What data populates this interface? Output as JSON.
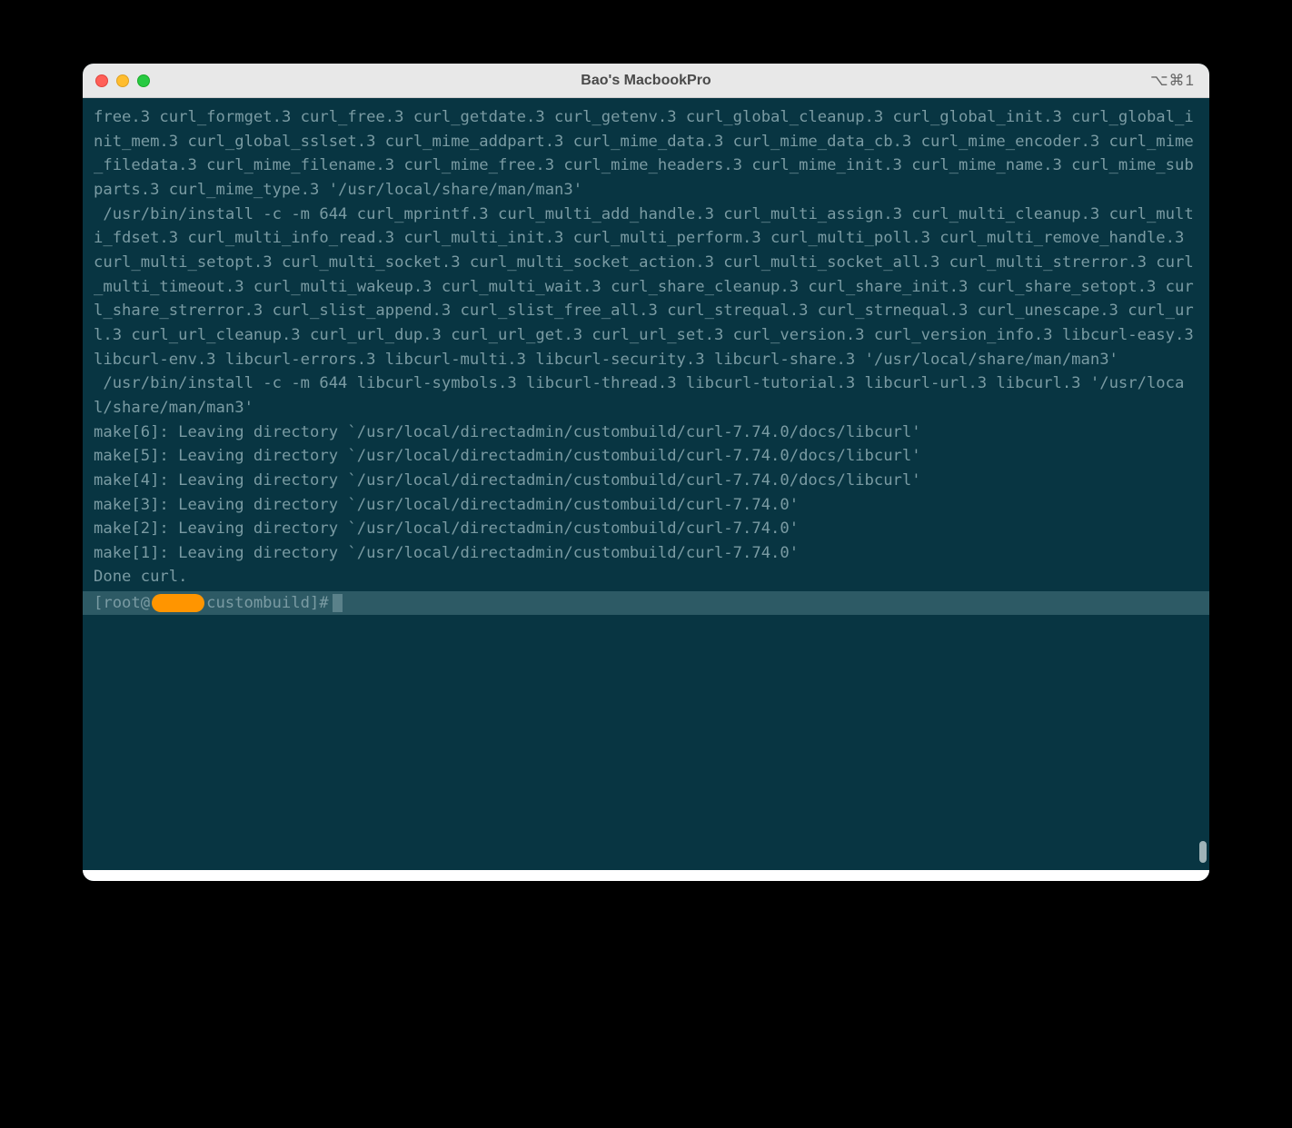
{
  "window": {
    "title": "Bao's MacbookPro",
    "shortcut": "⌥⌘1"
  },
  "terminal": {
    "output": "free.3 curl_formget.3 curl_free.3 curl_getdate.3 curl_getenv.3 curl_global_cleanup.3 curl_global_init.3 curl_global_init_mem.3 curl_global_sslset.3 curl_mime_addpart.3 curl_mime_data.3 curl_mime_data_cb.3 curl_mime_encoder.3 curl_mime_filedata.3 curl_mime_filename.3 curl_mime_free.3 curl_mime_headers.3 curl_mime_init.3 curl_mime_name.3 curl_mime_subparts.3 curl_mime_type.3 '/usr/local/share/man/man3'\n /usr/bin/install -c -m 644 curl_mprintf.3 curl_multi_add_handle.3 curl_multi_assign.3 curl_multi_cleanup.3 curl_multi_fdset.3 curl_multi_info_read.3 curl_multi_init.3 curl_multi_perform.3 curl_multi_poll.3 curl_multi_remove_handle.3 curl_multi_setopt.3 curl_multi_socket.3 curl_multi_socket_action.3 curl_multi_socket_all.3 curl_multi_strerror.3 curl_multi_timeout.3 curl_multi_wakeup.3 curl_multi_wait.3 curl_share_cleanup.3 curl_share_init.3 curl_share_setopt.3 curl_share_strerror.3 curl_slist_append.3 curl_slist_free_all.3 curl_strequal.3 curl_strnequal.3 curl_unescape.3 curl_url.3 curl_url_cleanup.3 curl_url_dup.3 curl_url_get.3 curl_url_set.3 curl_version.3 curl_version_info.3 libcurl-easy.3 libcurl-env.3 libcurl-errors.3 libcurl-multi.3 libcurl-security.3 libcurl-share.3 '/usr/local/share/man/man3'\n /usr/bin/install -c -m 644 libcurl-symbols.3 libcurl-thread.3 libcurl-tutorial.3 libcurl-url.3 libcurl.3 '/usr/local/share/man/man3'\nmake[6]: Leaving directory `/usr/local/directadmin/custombuild/curl-7.74.0/docs/libcurl'\nmake[5]: Leaving directory `/usr/local/directadmin/custombuild/curl-7.74.0/docs/libcurl'\nmake[4]: Leaving directory `/usr/local/directadmin/custombuild/curl-7.74.0/docs/libcurl'\nmake[3]: Leaving directory `/usr/local/directadmin/custombuild/curl-7.74.0'\nmake[2]: Leaving directory `/usr/local/directadmin/custombuild/curl-7.74.0'\nmake[1]: Leaving directory `/usr/local/directadmin/custombuild/curl-7.74.0'\nDone curl.",
    "prompt_prefix": "[root@",
    "prompt_suffix": " custombuild]# "
  }
}
